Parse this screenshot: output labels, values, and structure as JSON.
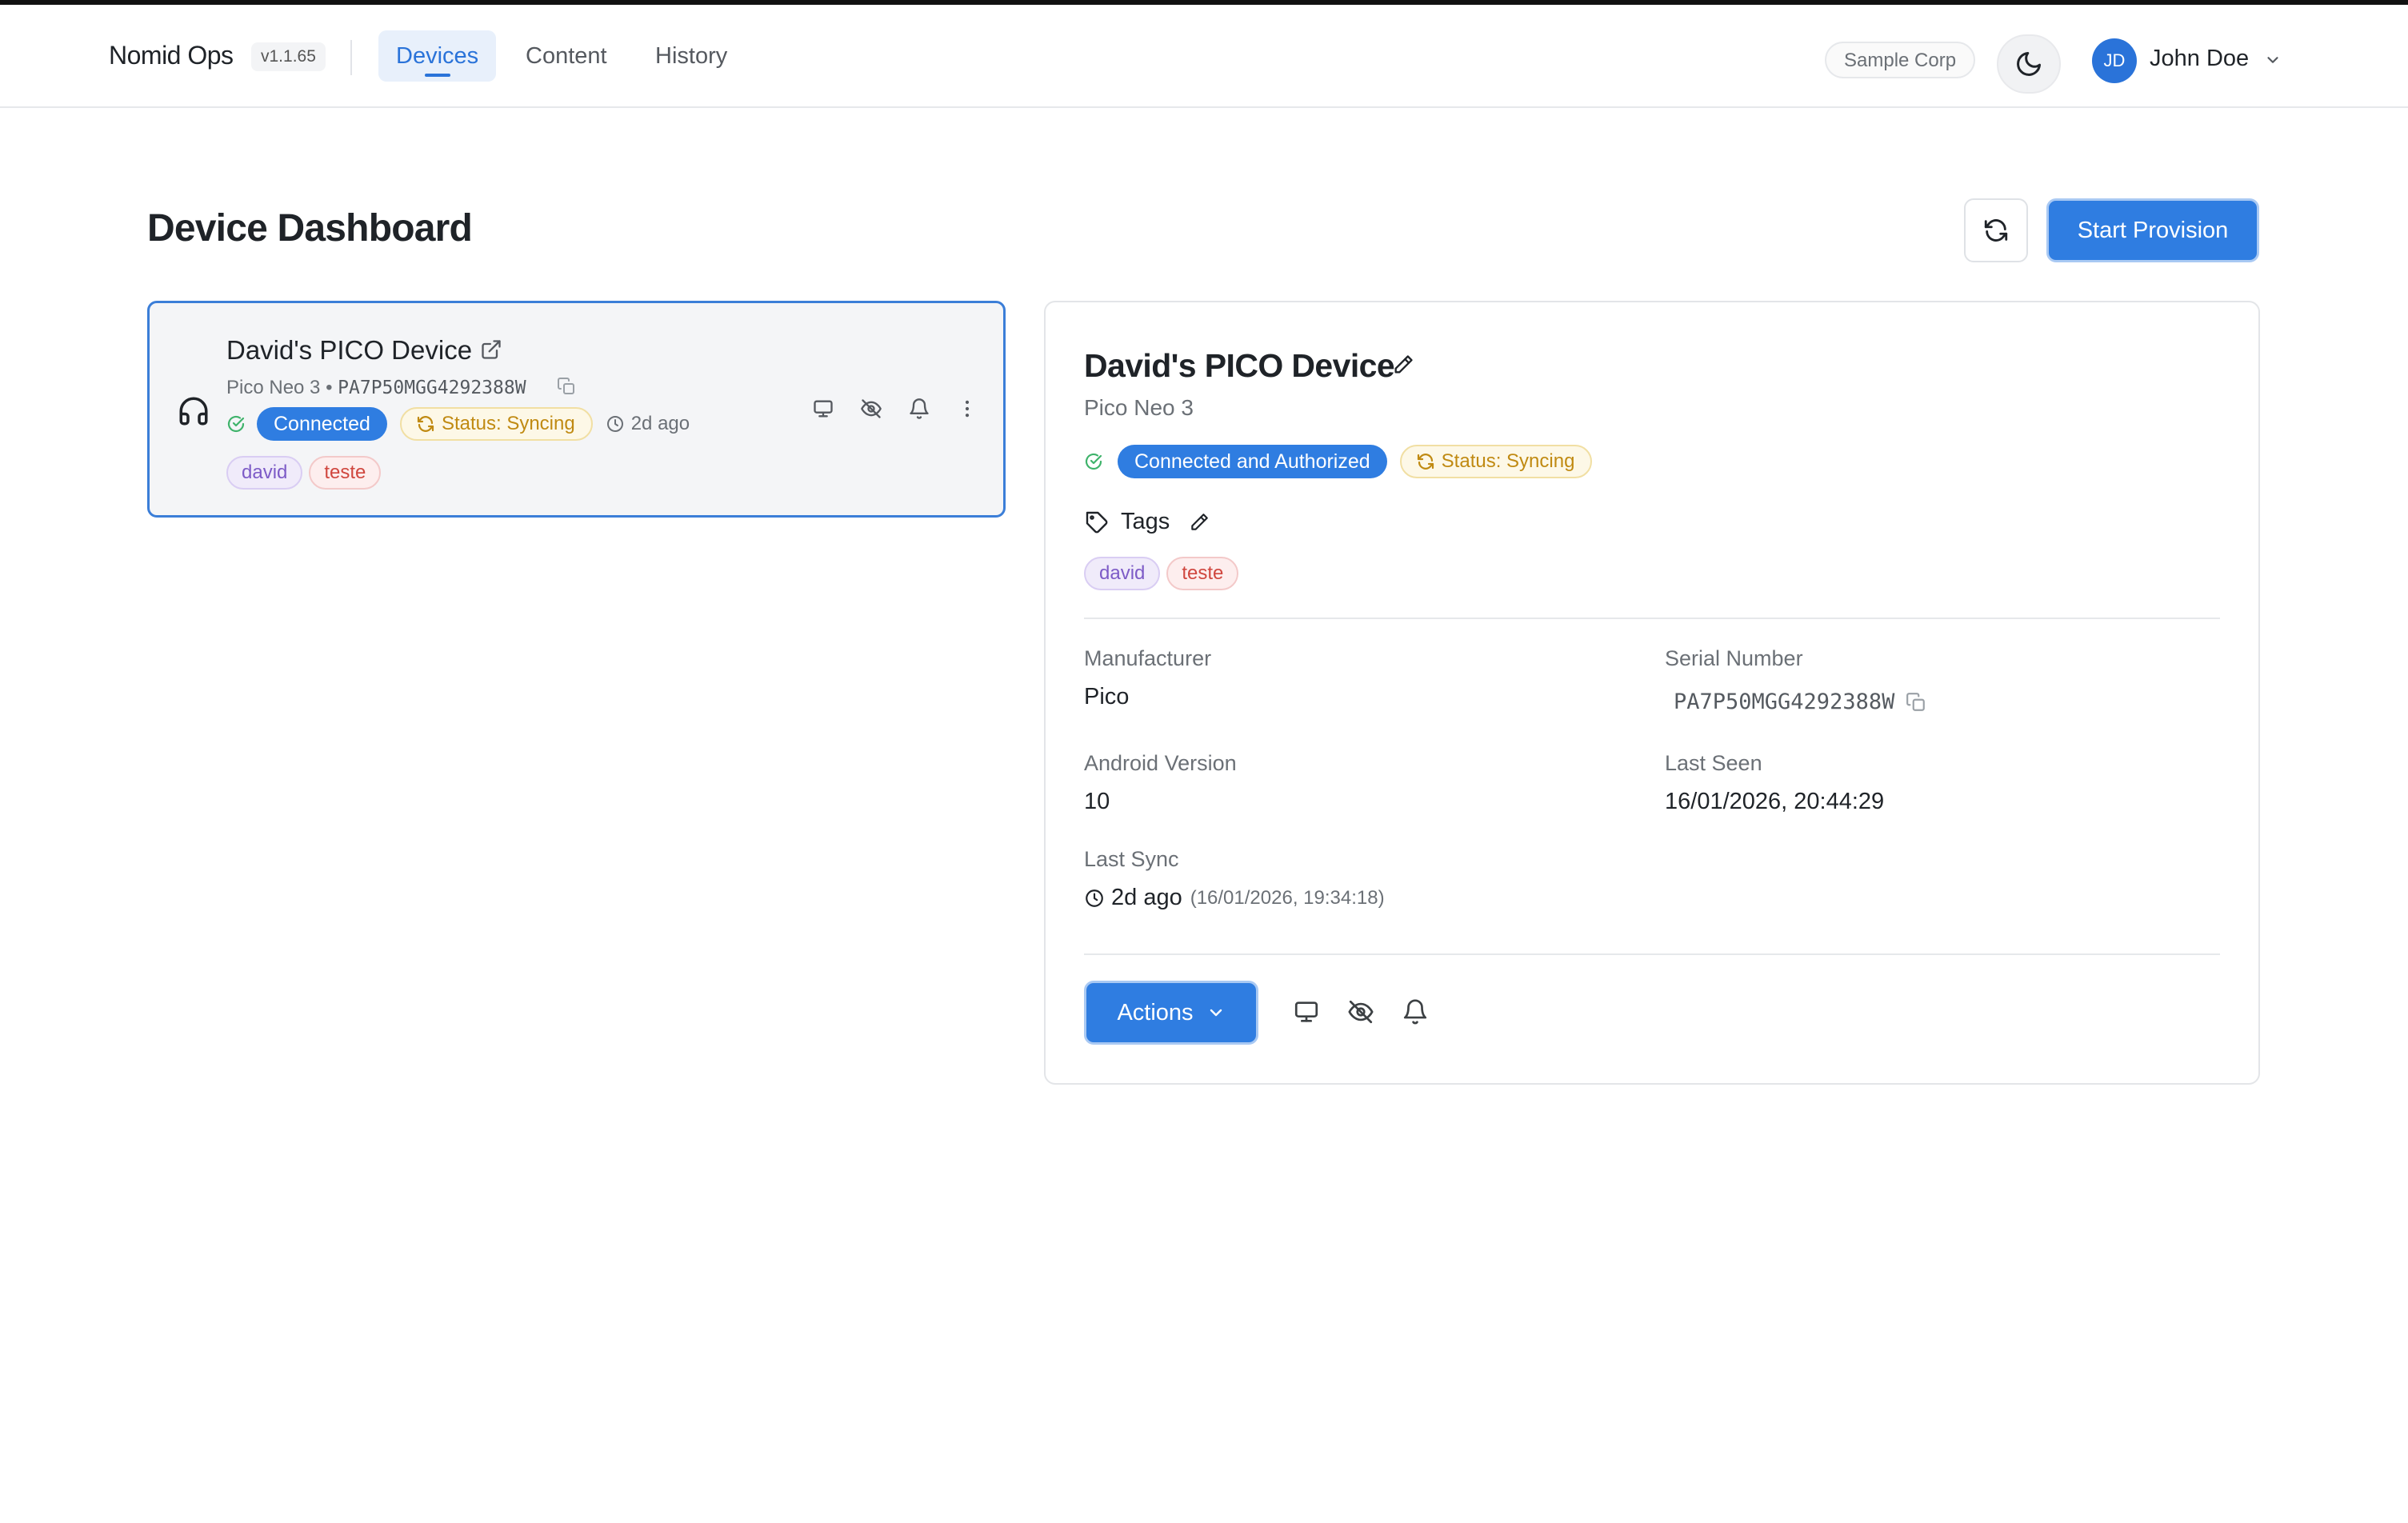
{
  "header": {
    "brand": "Nomid Ops",
    "version": "v1.1.65",
    "tabs": [
      {
        "label": "Devices",
        "active": true
      },
      {
        "label": "Content",
        "active": false
      },
      {
        "label": "History",
        "active": false
      }
    ],
    "org": "Sample Corp",
    "theme_icon": "moon-icon",
    "user": {
      "initials": "JD",
      "name": "John Doe"
    }
  },
  "page": {
    "title": "Device Dashboard",
    "refresh_icon": "refresh-icon",
    "provision_label": "Start Provision"
  },
  "device_list": [
    {
      "name": "David's PICO Device",
      "model": "Pico Neo 3",
      "serial": "PA7P50MGG4292388W",
      "connection": "Connected",
      "sync_status": "Status: Syncing",
      "last_seen_relative": "2d ago",
      "tags": [
        {
          "label": "david",
          "color": "#7d5bc7"
        },
        {
          "label": "teste",
          "color": "#d0473f"
        }
      ]
    }
  ],
  "detail": {
    "name": "David's PICO Device",
    "model": "Pico Neo 3",
    "connection": "Connected and Authorized",
    "sync_status": "Status: Syncing",
    "tags_label": "Tags",
    "tags": [
      {
        "label": "david",
        "color": "#7d5bc7"
      },
      {
        "label": "teste",
        "color": "#d0473f"
      }
    ],
    "fields": {
      "manufacturer_label": "Manufacturer",
      "manufacturer": "Pico",
      "serial_label": "Serial Number",
      "serial": "PA7P50MGG4292388W",
      "android_label": "Android Version",
      "android": "10",
      "last_seen_label": "Last Seen",
      "last_seen": "16/01/2026, 20:44:29",
      "last_sync_label": "Last Sync",
      "last_sync_relative": "2d ago",
      "last_sync_absolute": "(16/01/2026, 19:34:18)"
    },
    "actions_label": "Actions"
  },
  "colors": {
    "accent": "#2f7de1",
    "success": "#3fb36b",
    "syncing": "#c08a12",
    "tag_purple": "#7d5bc7",
    "tag_red": "#d0473f"
  }
}
